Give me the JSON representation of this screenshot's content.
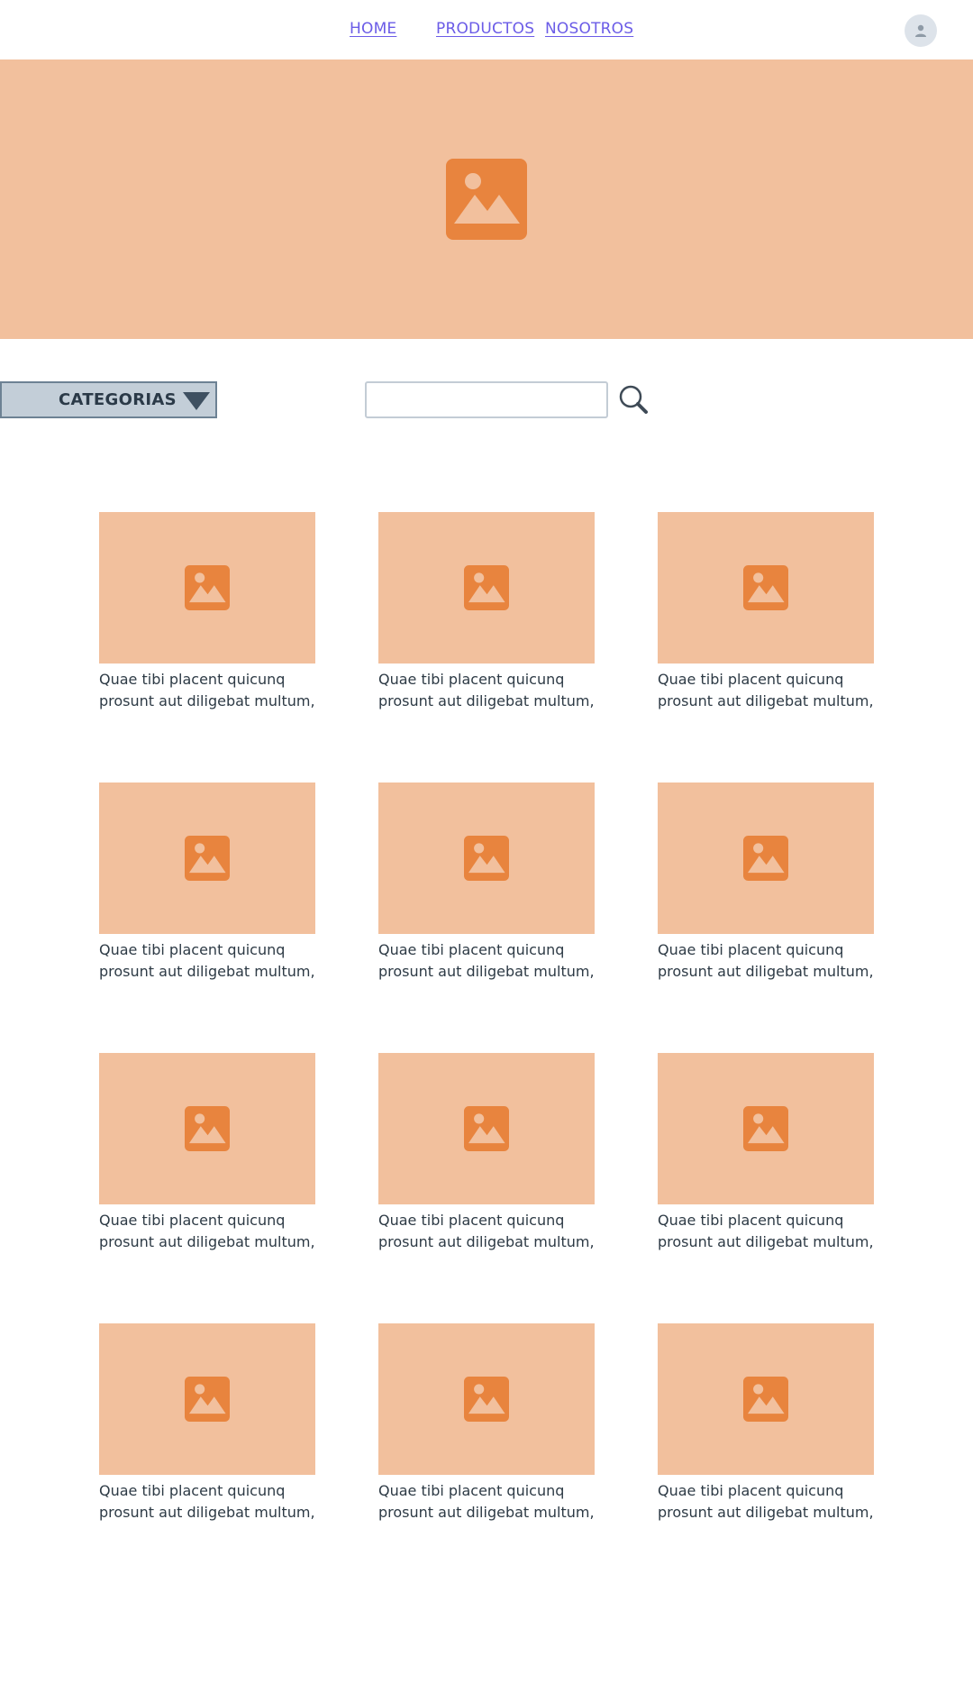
{
  "nav": {
    "home": "HOME",
    "productos": "PRODUCTOS",
    "nosotros": "NOSOTROS",
    "avatar_icon": "user-avatar-icon"
  },
  "hero": {
    "icon": "image-placeholder-icon"
  },
  "filters": {
    "categories_label": "CATEGORIAS",
    "search_value": "",
    "search_icon": "search-icon"
  },
  "colors": {
    "placeholder_bg": "#f2c09d",
    "placeholder_icon": "#e8843e",
    "link": "#6b5ce7",
    "dropdown_bg": "#c3ced8"
  },
  "products": [
    {
      "line1": "Quae tibi placent quicunq",
      "line2": "prosunt aut diligebat multum,"
    },
    {
      "line1": "Quae tibi placent quicunq",
      "line2": "prosunt aut diligebat multum,"
    },
    {
      "line1": "Quae tibi placent quicunq",
      "line2": "prosunt aut diligebat multum,"
    },
    {
      "line1": "Quae tibi placent quicunq",
      "line2": "prosunt aut diligebat multum,"
    },
    {
      "line1": "Quae tibi placent quicunq",
      "line2": "prosunt aut diligebat multum,"
    },
    {
      "line1": "Quae tibi placent quicunq",
      "line2": "prosunt aut diligebat multum,"
    },
    {
      "line1": "Quae tibi placent quicunq",
      "line2": "prosunt aut diligebat multum,"
    },
    {
      "line1": "Quae tibi placent quicunq",
      "line2": "prosunt aut diligebat multum,"
    },
    {
      "line1": "Quae tibi placent quicunq",
      "line2": "prosunt aut diligebat multum,"
    },
    {
      "line1": "Quae tibi placent quicunq",
      "line2": "prosunt aut diligebat multum,"
    },
    {
      "line1": "Quae tibi placent quicunq",
      "line2": "prosunt aut diligebat multum,"
    },
    {
      "line1": "Quae tibi placent quicunq",
      "line2": "prosunt aut diligebat multum,"
    }
  ]
}
